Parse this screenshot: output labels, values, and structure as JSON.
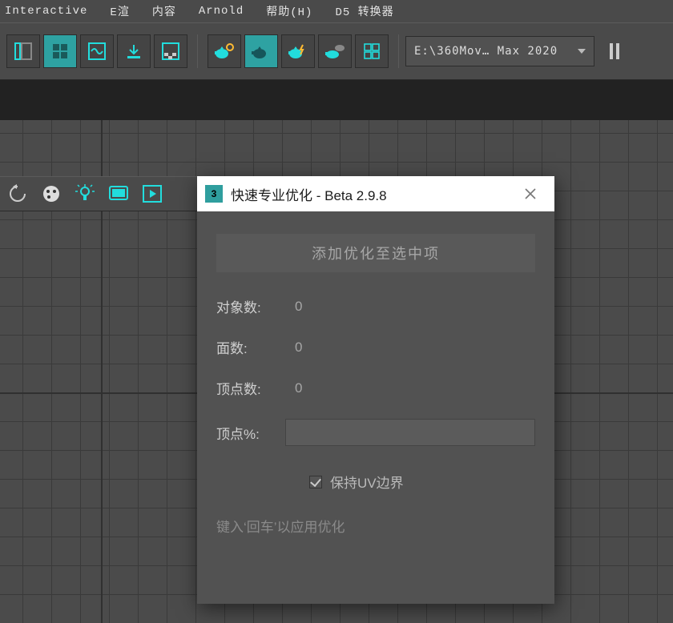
{
  "menu": {
    "items": [
      "Interactive",
      "E渲",
      "内容",
      "Arnold",
      "帮助(H)",
      "D5 转换器"
    ]
  },
  "toolbar": {
    "path_display": "E:\\360Mov… Max 2020"
  },
  "dialog": {
    "title": "快速专业优化 - Beta 2.9.8",
    "add_button": "添加优化至选中项",
    "obj_label": "对象数:",
    "obj_value": "0",
    "face_label": "面数:",
    "face_value": "0",
    "vert_label": "顶点数:",
    "vert_value": "0",
    "vpct_label": "顶点%:",
    "keep_uv_label": "保持UV边界",
    "hint": "键入‘回车’以应用优化"
  }
}
